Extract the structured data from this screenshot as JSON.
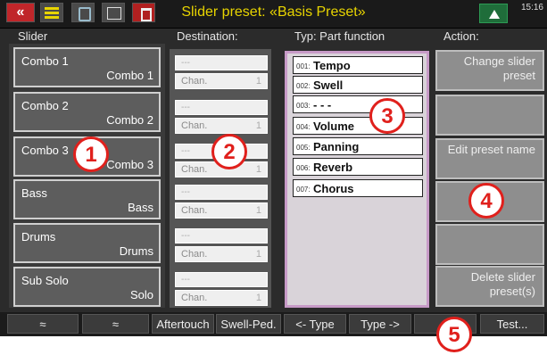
{
  "title": "Slider preset: «Basis Preset»",
  "clock": "15:16",
  "headers": {
    "slider": "Slider",
    "destination": "Destination:",
    "typ": "Typ:  Part function",
    "action": "Action:"
  },
  "sliders": [
    {
      "top_label": "Combo 1",
      "bottom_label": "Combo 1"
    },
    {
      "top_label": "Combo 2",
      "bottom_label": "Combo 2"
    },
    {
      "top_label": "Combo 3",
      "bottom_label": "Combo 3"
    },
    {
      "top_label": "Bass",
      "bottom_label": "Bass"
    },
    {
      "top_label": "Drums",
      "bottom_label": "Drums"
    },
    {
      "top_label": "Sub Solo",
      "bottom_label": "Solo"
    }
  ],
  "destinations": [
    {
      "value": "---",
      "chan_label": "Chan.",
      "chan_value": "1"
    },
    {
      "value": "---",
      "chan_label": "Chan.",
      "chan_value": "1"
    },
    {
      "value": "---",
      "chan_label": "Chan.",
      "chan_value": "1"
    },
    {
      "value": "---",
      "chan_label": "Chan.",
      "chan_value": "1"
    },
    {
      "value": "---",
      "chan_label": "Chan.",
      "chan_value": "1"
    },
    {
      "value": "---",
      "chan_label": "Chan.",
      "chan_value": "1"
    }
  ],
  "typ_items": [
    {
      "num": "001:",
      "name": "Tempo"
    },
    {
      "num": "002:",
      "name": "Swell"
    },
    {
      "num": "003:",
      "name": "- - -"
    },
    {
      "num": "004:",
      "name": "Volume"
    },
    {
      "num": "005:",
      "name": "Panning"
    },
    {
      "num": "006:",
      "name": "Reverb"
    },
    {
      "num": "007:",
      "name": "Chorus"
    }
  ],
  "actions": [
    "Change slider preset",
    "",
    "Edit preset name",
    "",
    "",
    "Delete slider preset(s)"
  ],
  "footer": {
    "up": "≈",
    "down": "≈",
    "aftertouch": "Aftertouch",
    "swell": "Swell-Ped.",
    "type_prev": "<- Type",
    "type_next": "Type ->",
    "test": "Test..."
  },
  "markers": [
    "1",
    "2",
    "3",
    "4",
    "5"
  ],
  "colors": {
    "title": "#e8d400",
    "marker": "#e0201c",
    "typ_border": "#c79ac7"
  }
}
